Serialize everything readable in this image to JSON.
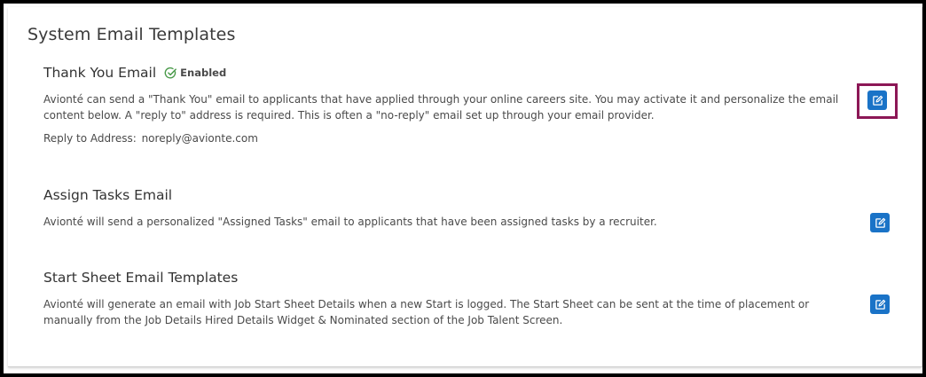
{
  "page": {
    "title": "System Email Templates"
  },
  "templates": [
    {
      "title": "Thank You Email",
      "status": "Enabled",
      "description": "Avionté can send a \"Thank You\" email to applicants that have applied through your online careers site. You may activate it and personalize the email content below. A \"reply to\" address is required. This is often a \"no-reply\" email set up through your email provider.",
      "reply_label": "Reply to Address:",
      "reply_value": "noreply@avionte.com",
      "edit_icon": "edit-icon"
    },
    {
      "title": "Assign Tasks Email",
      "description": "Avionté will send a personalized \"Assigned Tasks\" email to applicants that have been assigned tasks by a recruiter.",
      "edit_icon": "edit-icon"
    },
    {
      "title": "Start Sheet Email Templates",
      "description": "Avionté will generate an email with Job Start Sheet Details when a new Start is logged. The Start Sheet can be sent at the time of placement or manually from the Job Details Hired Details Widget & Nominated section of the Job Talent Screen.",
      "edit_icon": "edit-icon"
    }
  ],
  "colors": {
    "edit_button": "#1a73c7",
    "enabled_check": "#4a9a4a",
    "highlight_border": "#8c1756"
  }
}
